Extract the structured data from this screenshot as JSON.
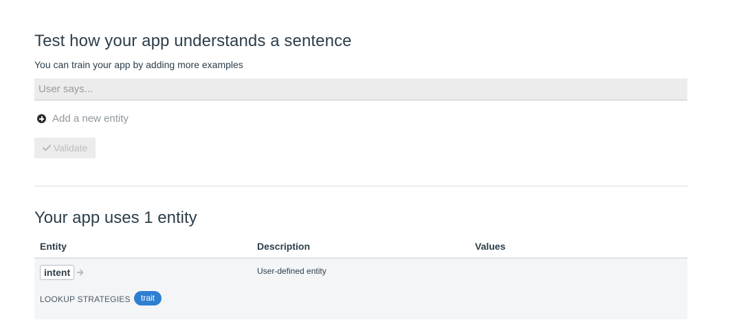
{
  "test_section": {
    "title": "Test how your app understands a sentence",
    "subtitle": "You can train your app by adding more examples",
    "input_placeholder": "User says...",
    "input_value": "",
    "add_entity_label": "Add a new entity",
    "validate_label": "Validate"
  },
  "entities_section": {
    "title": "Your app uses 1 entity",
    "columns": [
      "Entity",
      "Description",
      "Values"
    ],
    "rows": [
      {
        "entity": "intent",
        "description": "User-defined entity",
        "values": "",
        "lookup_label": "LOOKUP STRATEGIES",
        "strategy": "trait"
      }
    ]
  },
  "colors": {
    "text": "#2c3e4a",
    "input_bg": "#ececec",
    "badge_blue": "#2f7fd0",
    "row_bg": "#f3f5f7",
    "muted": "#8f969b"
  },
  "icons": {
    "add": "plus-circle-icon",
    "validate": "check-icon",
    "entity_link": "arrow-right-icon"
  }
}
